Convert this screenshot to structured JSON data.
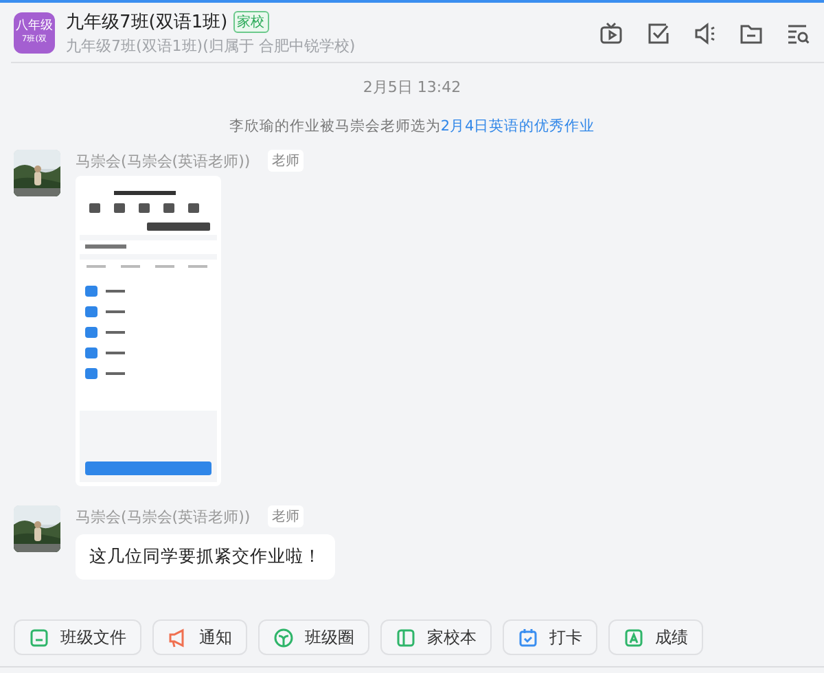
{
  "header": {
    "logo_lines": [
      "八年级",
      "7班(双"
    ],
    "title": "九年级7班(双语1班)",
    "badge": "家校",
    "subtitle": "九年级7班(双语1班)(归属于 合肥中锐学校)"
  },
  "timestamp": "2月5日 13:42",
  "notice": {
    "text": "李欣瑜的作业被马崇会老师选为",
    "link": "2月4日英语的优秀作业"
  },
  "messages": [
    {
      "sender": "马崇会(马崇会(英语老师))",
      "role": "老师",
      "kind": "screenshot"
    },
    {
      "sender": "马崇会(马崇会(英语老师))",
      "role": "老师",
      "kind": "text",
      "text": "这几位同学要抓紧交作业啦！"
    }
  ],
  "actions": [
    {
      "label": "班级文件"
    },
    {
      "label": "通知"
    },
    {
      "label": "班级圈"
    },
    {
      "label": "家校本"
    },
    {
      "label": "打卡"
    },
    {
      "label": "成绩"
    }
  ]
}
